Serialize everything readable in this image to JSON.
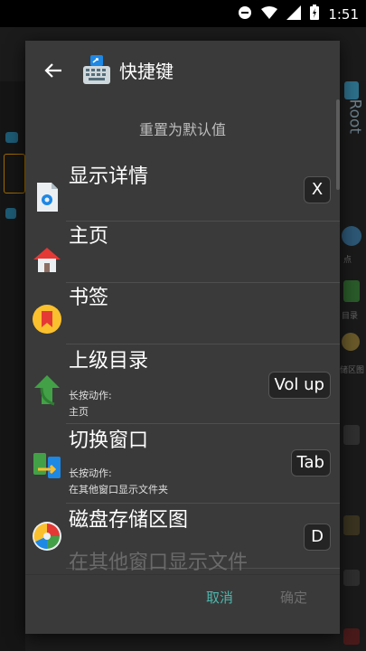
{
  "status": {
    "time": "1:51"
  },
  "background": {
    "root_label": "Root",
    "right_labels": [
      "点",
      "目录",
      "储区图"
    ]
  },
  "dialog": {
    "title": "快捷键",
    "reset_label": "重置为默认值",
    "items": [
      {
        "label": "显示详情",
        "key": "X",
        "icon": "info-file-icon"
      },
      {
        "label": "主页",
        "key": "",
        "icon": "home-icon"
      },
      {
        "label": "书签",
        "key": "",
        "icon": "bookmark-icon"
      },
      {
        "label": "上级目录",
        "key": "Vol up",
        "sub_title": "长按动作:",
        "sub_value": "主页",
        "icon": "up-arrow-icon"
      },
      {
        "label": "切换窗口",
        "key": "Tab",
        "sub_title": "长按动作:",
        "sub_value": "在其他窗口显示文件夹",
        "icon": "switch-window-icon"
      },
      {
        "label": "磁盘存储区图",
        "key": "D",
        "icon": "disk-map-icon"
      }
    ],
    "partial_item": "在其他窗口显示文件",
    "buttons": {
      "cancel": "取消",
      "ok": "确定"
    }
  },
  "colors": {
    "accent": "#4db6ac",
    "dialog_bg": "#3a3a3a"
  }
}
